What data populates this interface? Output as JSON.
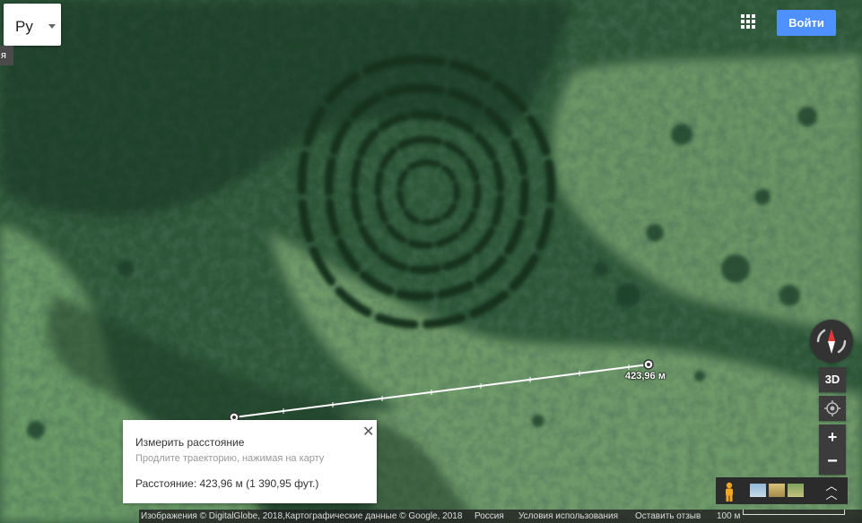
{
  "language": {
    "value": "Ру",
    "side_tab": "я"
  },
  "header": {
    "apps_icon": "apps-grid-icon",
    "signin_label": "Войти",
    "signin_color": "#4d90fe"
  },
  "measurement": {
    "distance_label": "423,96 м",
    "panel": {
      "title": "Измерить расстояние",
      "hint": "Продлите траекторию, нажимая на карту",
      "distance_text": "Расстояние: 423,96 м (1 390,95 фут.)",
      "close_icon": "close-icon"
    }
  },
  "controls": {
    "compass_icon": "compass-icon",
    "view_3d_label": "3D",
    "my_location_icon": "my-location-icon",
    "zoom_in_label": "+",
    "zoom_out_label": "−",
    "pegman_icon": "pegman-icon",
    "expand_icon": "chevron-up-double-icon"
  },
  "footer": {
    "imagery_credit": "Изображения © DigitalGlobe, 2018,Картографические данные © Google, 2018",
    "country": "Россия",
    "terms": "Условия использования",
    "feedback": "Оставить отзыв",
    "scale": "100 м"
  },
  "colors": {
    "forest_dark": "#1d3f2a",
    "meadow": "#5f8f5c",
    "accent_blue": "#4d90fe"
  }
}
